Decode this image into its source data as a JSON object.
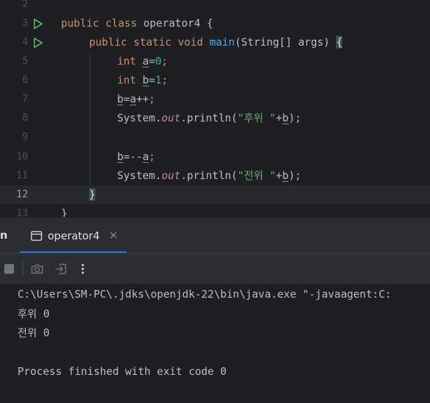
{
  "editor": {
    "lines": [
      {
        "num": "2"
      },
      {
        "num": "3"
      },
      {
        "num": "4"
      },
      {
        "num": "5"
      },
      {
        "num": "6"
      },
      {
        "num": "7"
      },
      {
        "num": "8"
      },
      {
        "num": "9"
      },
      {
        "num": "10"
      },
      {
        "num": "11"
      },
      {
        "num": "12"
      },
      {
        "num": "13"
      }
    ],
    "tokens": {
      "public": "public",
      "class": "class",
      "class_name": "operator4",
      "open_brace": "{",
      "static": "static",
      "void": "void",
      "main": "main",
      "main_params": "(String[] args)",
      "int": "int",
      "var_a": "a",
      "var_b": "b",
      "assign": "=",
      "zero": "0",
      "one": "1",
      "semicolon": ";",
      "incr": "++",
      "pre_decr": "--",
      "system": "System.",
      "out": "out",
      "println": ".println(",
      "str_after": "\"후위 \"",
      "str_before": "\"전위 \"",
      "plus": "+",
      "close_call": ");",
      "close_brace": "}"
    }
  },
  "tool_window": {
    "title_stub": "n",
    "tab_label": "operator4",
    "tab_close": "×"
  },
  "console": {
    "command": "C:\\Users\\SM-PC\\.jdks\\openjdk-22\\bin\\java.exe \"-javaagent:C:",
    "output_1": "후위 0",
    "output_2": "전위 0",
    "exit_message": "Process finished with exit code 0"
  },
  "icons": {
    "run_gutter": "run-triangle-icon",
    "tab": "console-window-icon",
    "stop": "stop-icon",
    "screenshot": "camera-icon",
    "export": "export-icon",
    "more": "more-vertical-icon"
  },
  "colors": {
    "accent": "#3574f0",
    "run_green": "#5fb865"
  }
}
